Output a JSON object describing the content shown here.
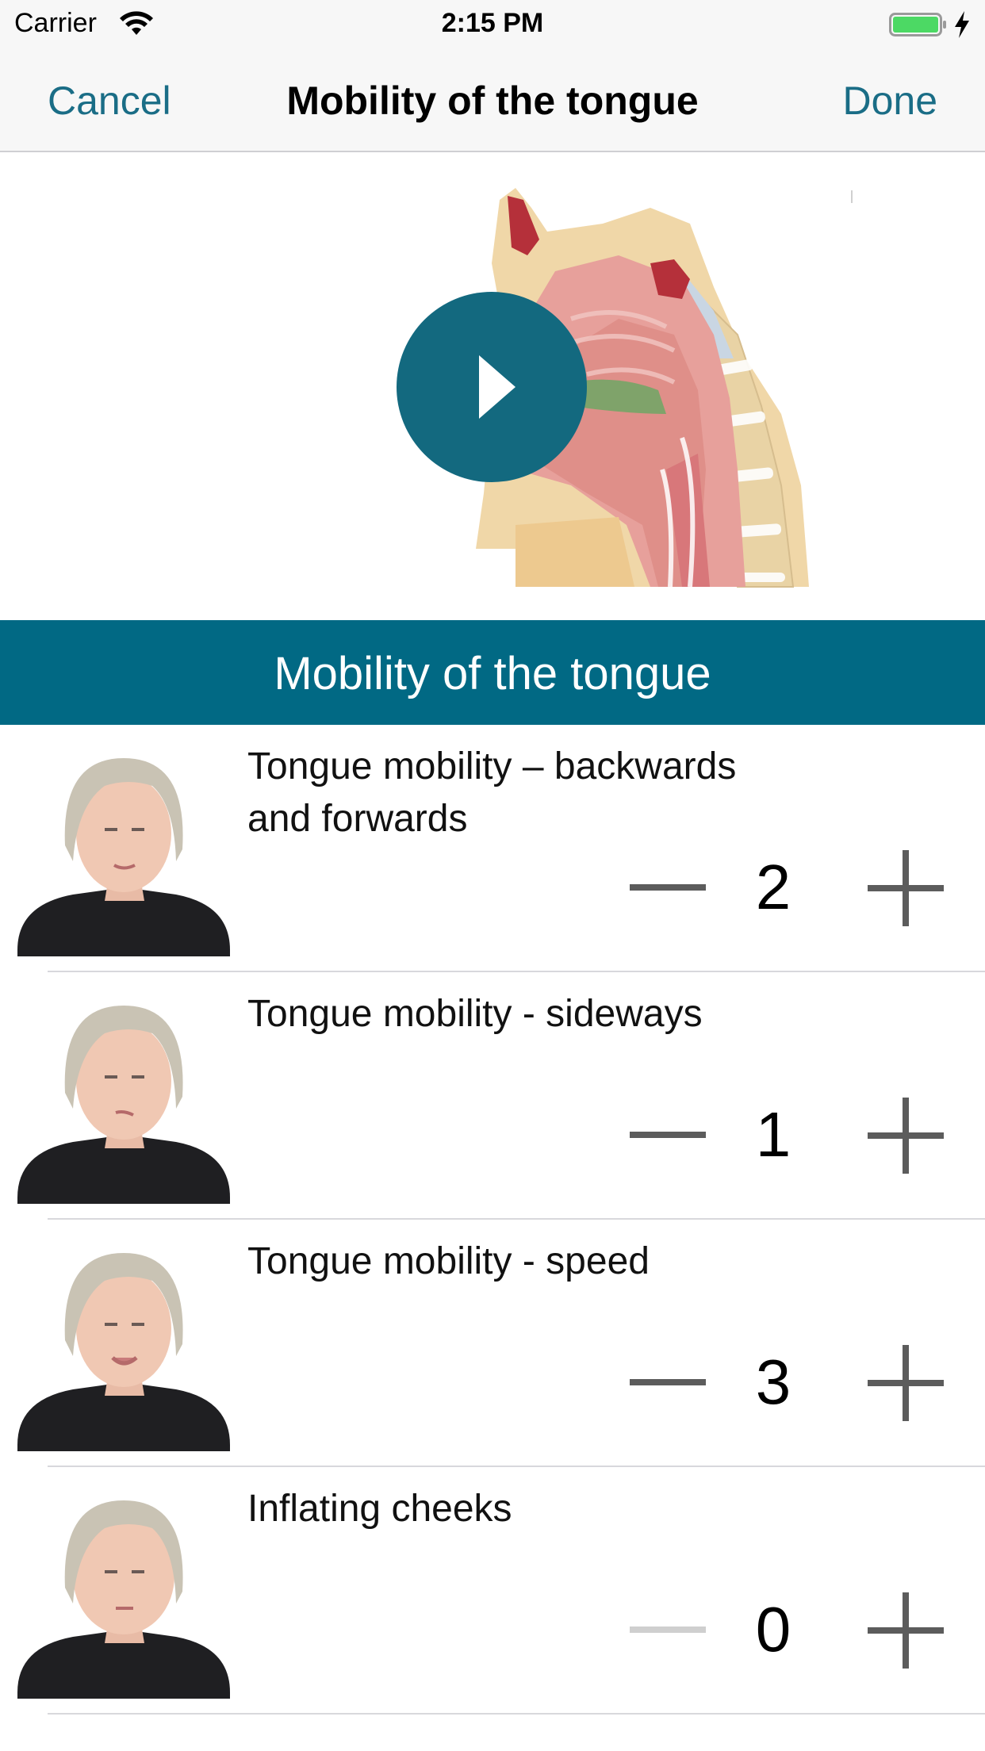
{
  "status_bar": {
    "carrier": "Carrier",
    "time": "2:15 PM"
  },
  "nav": {
    "cancel_label": "Cancel",
    "title": "Mobility of the tongue",
    "done_label": "Done"
  },
  "video": {
    "play_icon": "play-icon"
  },
  "section": {
    "title": "Mobility of the tongue"
  },
  "items": [
    {
      "label": "Tongue mobility – backwards and forwards",
      "value": "2",
      "minus_enabled": true
    },
    {
      "label": "Tongue mobility - sideways",
      "value": "1",
      "minus_enabled": true
    },
    {
      "label": "Tongue mobility - speed",
      "value": "3",
      "minus_enabled": true
    },
    {
      "label": "Inflating cheeks",
      "value": "0",
      "minus_enabled": false
    }
  ],
  "colors": {
    "accent": "#1a6d86",
    "section_bg": "#016984",
    "play_bg": "#13697f"
  }
}
